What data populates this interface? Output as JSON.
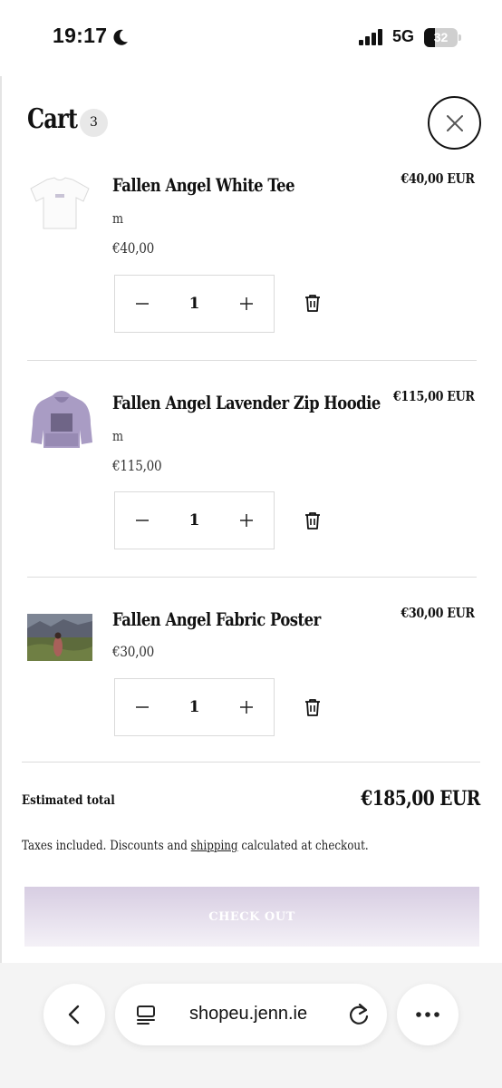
{
  "status_bar": {
    "time": "19:17",
    "network": "5G",
    "battery": "32",
    "battery_level": 0.32
  },
  "cart": {
    "title": "Cart",
    "count": "3"
  },
  "items": [
    {
      "name": "Fallen Angel White Tee",
      "variant": "m",
      "unit_price": "€40,00",
      "line_price": "€40,00 EUR",
      "quantity": "1"
    },
    {
      "name": "Fallen Angel Lavender Zip Hoodie",
      "variant": "m",
      "unit_price": "€115,00",
      "line_price": "€115,00 EUR",
      "quantity": "1"
    },
    {
      "name": "Fallen Angel Fabric Poster",
      "unit_price": "€30,00",
      "line_price": "€30,00 EUR",
      "quantity": "1"
    }
  ],
  "summary": {
    "estimated_label": "Estimated total",
    "estimated_value": "€185,00 EUR",
    "tax_prefix": "Taxes included. Discounts and ",
    "tax_link": "shipping",
    "tax_suffix": " calculated at checkout."
  },
  "checkout": {
    "label": "CHECK OUT",
    "accent": "#d7cde2"
  },
  "browser": {
    "url": "shopeu.jenn.ie"
  }
}
